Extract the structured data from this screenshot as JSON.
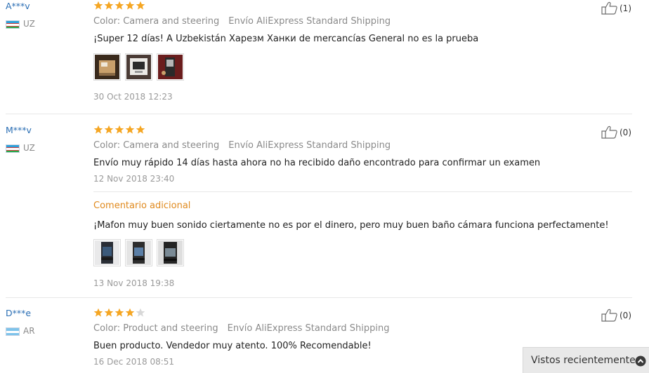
{
  "reviews": [
    {
      "user": "A***v",
      "country": "UZ",
      "stars": 5,
      "color_attr": "Color: Camera and steering",
      "shipping": "Envío AliExpress Standard Shipping",
      "text": "¡Super 12 días! A Uzbekistán Харезм Ханки de mercancías General no es la prueba",
      "photos": 3,
      "date": "30 Oct 2018 12:23",
      "likes": "(1)"
    },
    {
      "user": "M***v",
      "country": "UZ",
      "stars": 5,
      "color_attr": "Color: Camera and steering",
      "shipping": "Envío AliExpress Standard Shipping",
      "text": "Envío muy rápido 14 días hasta ahora no ha recibido daño encontrado para confirmar un examen",
      "date": "12 Nov 2018 23:40",
      "additional_label": "Comentario adicional",
      "additional_text": "¡Mafon muy buen sonido ciertamente no es por el dinero, pero muy buen baño cámara funciona perfectamente!",
      "additional_photos": 3,
      "additional_date": "13 Nov 2018 19:38",
      "likes": "(0)"
    },
    {
      "user": "D***e",
      "country": "AR",
      "stars": 4,
      "color_attr": "Color: Product and steering",
      "shipping": "Envío AliExpress Standard Shipping",
      "text": "Buen producto. Vendedor muy atento. 100% Recomendable!",
      "date": "16 Dec 2018 08:51",
      "likes": "(0)"
    }
  ],
  "recently_viewed": {
    "label": "Vistos recientemente",
    "icon": "chevron-up-circle-icon"
  },
  "colors": {
    "star": "#f5a623",
    "star_empty": "#d8d8d8",
    "link": "#2a6eb4",
    "accent": "#e08a1e"
  }
}
